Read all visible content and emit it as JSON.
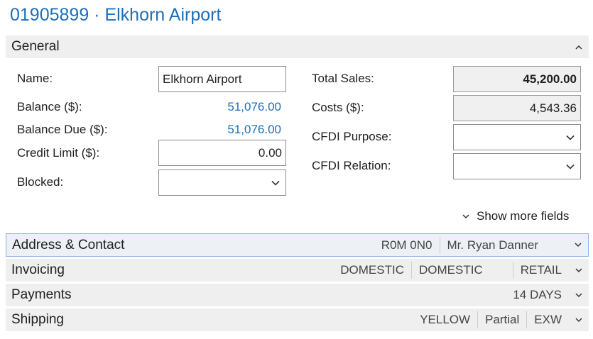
{
  "page": {
    "title": "01905899 · Elkhorn Airport"
  },
  "general": {
    "title": "General",
    "labels": {
      "name": "Name:",
      "balance": "Balance ($):",
      "balance_due": "Balance Due ($):",
      "credit_limit": "Credit Limit ($):",
      "blocked": "Blocked:",
      "total_sales": "Total Sales:",
      "costs": "Costs ($):",
      "cfdi_purpose": "CFDI Purpose:",
      "cfdi_relation": "CFDI Relation:"
    },
    "values": {
      "name": "Elkhorn Airport",
      "balance": "51,076.00",
      "balance_due": "51,076.00",
      "credit_limit": "0.00",
      "blocked": "",
      "total_sales": "45,200.00",
      "costs": "4,543.36",
      "cfdi_purpose": "",
      "cfdi_relation": ""
    },
    "show_more": "Show more fields"
  },
  "address_contact": {
    "title": "Address & Contact",
    "summary": [
      "R0M 0N0",
      "Mr. Ryan Danner"
    ]
  },
  "invoicing": {
    "title": "Invoicing",
    "summary": [
      "DOMESTIC",
      "DOMESTIC",
      "RETAIL"
    ]
  },
  "payments": {
    "title": "Payments",
    "summary": [
      "14 DAYS"
    ]
  },
  "shipping": {
    "title": "Shipping",
    "summary": [
      "YELLOW",
      "Partial",
      "EXW"
    ]
  },
  "colors": {
    "accent": "#1d6fb8",
    "section_bg": "#efefef",
    "focus_border": "#8cb4e2"
  },
  "icons": {
    "collapse": "chevron-up-icon",
    "expand": "chevron-down-icon",
    "dropdown": "chevron-down-icon"
  }
}
